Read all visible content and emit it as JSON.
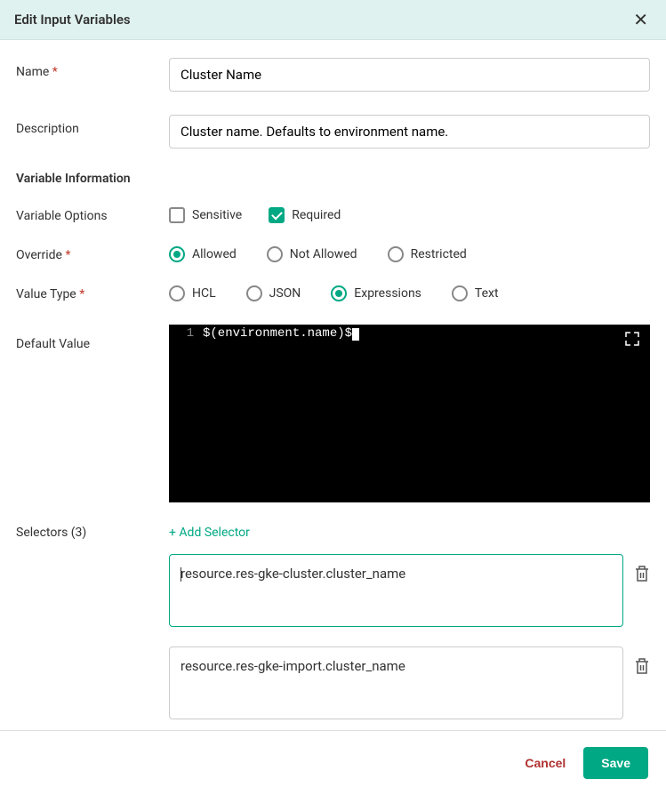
{
  "header": {
    "title": "Edit Input Variables"
  },
  "form": {
    "name_label": "Name",
    "name_value": "Cluster Name",
    "description_label": "Description",
    "description_value": "Cluster name. Defaults to environment name.",
    "variable_info_heading": "Variable Information",
    "variable_options_label": "Variable Options",
    "options": {
      "sensitive_label": "Sensitive",
      "sensitive_checked": false,
      "required_label": "Required",
      "required_checked": true
    },
    "override_label": "Override",
    "override_options": [
      {
        "label": "Allowed",
        "selected": true
      },
      {
        "label": "Not Allowed",
        "selected": false
      },
      {
        "label": "Restricted",
        "selected": false
      }
    ],
    "value_type_label": "Value Type",
    "value_type_options": [
      {
        "label": "HCL",
        "selected": false
      },
      {
        "label": "JSON",
        "selected": false
      },
      {
        "label": "Expressions",
        "selected": true
      },
      {
        "label": "Text",
        "selected": false
      }
    ],
    "default_value_label": "Default Value",
    "code": {
      "line_number": "1",
      "content": "$(environment.name)$"
    },
    "selectors_label": "Selectors (3)",
    "add_selector_label": "+ Add Selector",
    "selectors": [
      {
        "value": "resource.res-gke-cluster.cluster_name",
        "active": true
      },
      {
        "value": "resource.res-gke-import.cluster_name",
        "active": false
      }
    ]
  },
  "footer": {
    "cancel_label": "Cancel",
    "save_label": "Save"
  }
}
